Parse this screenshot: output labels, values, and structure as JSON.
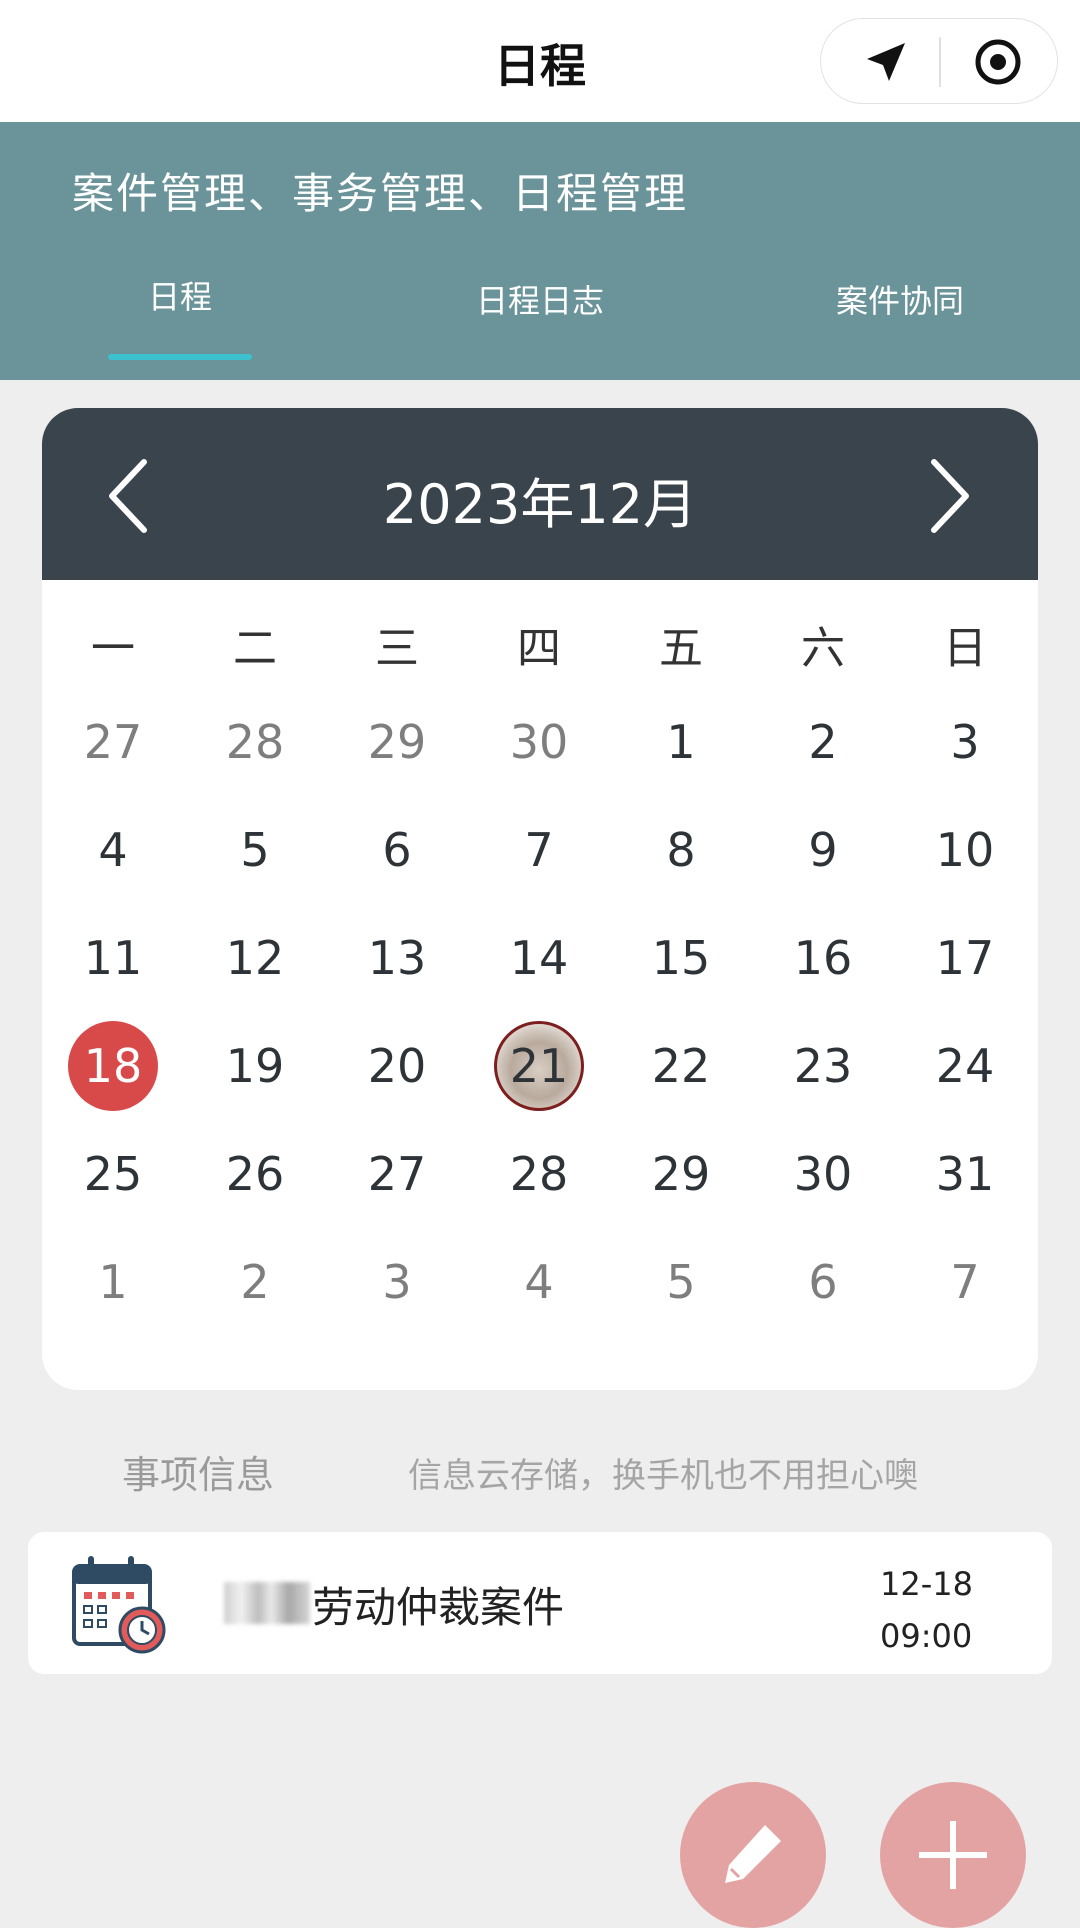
{
  "topbar": {
    "title": "日程",
    "icons": [
      "location-arrow-icon",
      "record-icon"
    ]
  },
  "header": {
    "subtitle": "案件管理、事务管理、日程管理",
    "tabs": [
      {
        "label": "日程",
        "active": true
      },
      {
        "label": "日程日志",
        "active": false
      },
      {
        "label": "案件协同",
        "active": false
      }
    ],
    "active_color": "#3cc2cf"
  },
  "calendar": {
    "month_label": "2023年12月",
    "weekdays": [
      "一",
      "二",
      "三",
      "四",
      "五",
      "六",
      "日"
    ],
    "weeks": [
      [
        {
          "d": "27",
          "other": true
        },
        {
          "d": "28",
          "other": true
        },
        {
          "d": "29",
          "other": true
        },
        {
          "d": "30",
          "other": true
        },
        {
          "d": "1"
        },
        {
          "d": "2"
        },
        {
          "d": "3"
        }
      ],
      [
        {
          "d": "4"
        },
        {
          "d": "5"
        },
        {
          "d": "6"
        },
        {
          "d": "7"
        },
        {
          "d": "8"
        },
        {
          "d": "9"
        },
        {
          "d": "10"
        }
      ],
      [
        {
          "d": "11"
        },
        {
          "d": "12"
        },
        {
          "d": "13"
        },
        {
          "d": "14"
        },
        {
          "d": "15"
        },
        {
          "d": "16"
        },
        {
          "d": "17"
        }
      ],
      [
        {
          "d": "18",
          "today": true
        },
        {
          "d": "19"
        },
        {
          "d": "20"
        },
        {
          "d": "21",
          "marked": true
        },
        {
          "d": "22"
        },
        {
          "d": "23"
        },
        {
          "d": "24"
        }
      ],
      [
        {
          "d": "25"
        },
        {
          "d": "26"
        },
        {
          "d": "27"
        },
        {
          "d": "28"
        },
        {
          "d": "29"
        },
        {
          "d": "30"
        },
        {
          "d": "31"
        }
      ],
      [
        {
          "d": "1",
          "other": true
        },
        {
          "d": "2",
          "other": true
        },
        {
          "d": "3",
          "other": true
        },
        {
          "d": "4",
          "other": true
        },
        {
          "d": "5",
          "other": true
        },
        {
          "d": "6",
          "other": true
        },
        {
          "d": "7",
          "other": true
        }
      ]
    ],
    "today_color": "#d84a4a",
    "header_color": "#3a444c"
  },
  "info": {
    "label": "事项信息",
    "hint": "信息云存储，换手机也不用担心噢"
  },
  "events": [
    {
      "title": "劳动仲裁案件",
      "date": "12-18",
      "time": "09:00",
      "icon": "calendar-clock-icon"
    }
  ],
  "fabs": [
    {
      "icon": "pencil-icon"
    },
    {
      "icon": "plus-icon"
    }
  ],
  "colors": {
    "teal_header": "#6a9499",
    "fab": "#e4a3a3"
  }
}
